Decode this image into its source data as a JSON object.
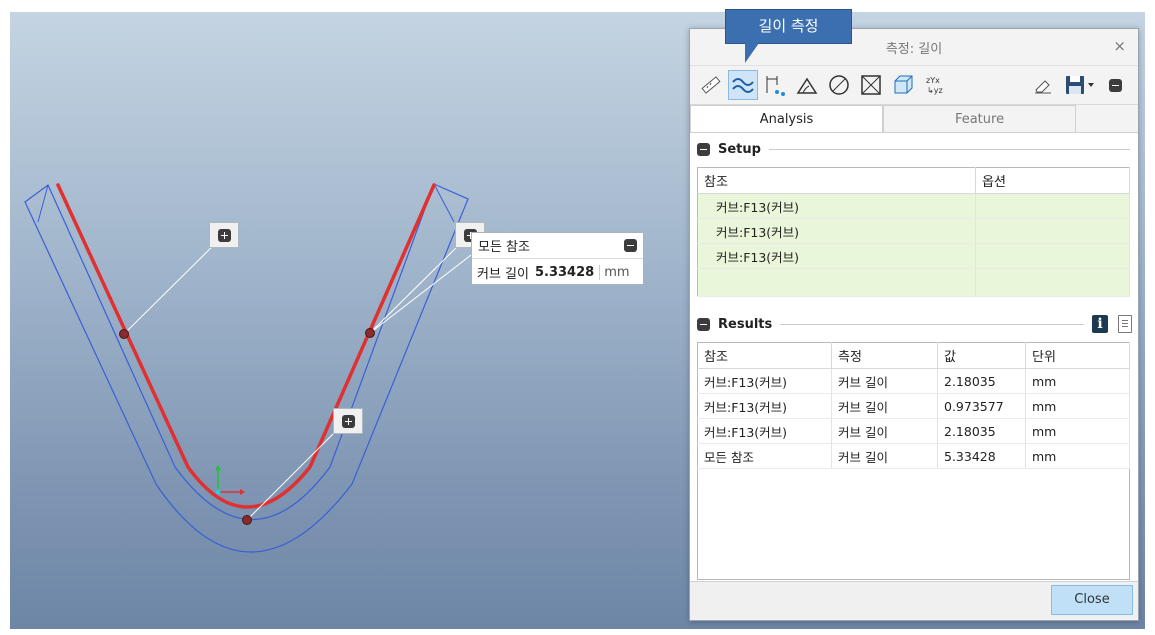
{
  "callout": "길이 측정",
  "window": {
    "title": "측정: 길이",
    "close_icon": "×"
  },
  "toolbar": {
    "tools": [
      "ruler-icon",
      "curve-length-icon",
      "distance-icon",
      "angle-icon",
      "diameter-icon",
      "area-icon",
      "volume-icon",
      "transform-icon"
    ],
    "right_tools": [
      "eraser-icon",
      "save-icon",
      "collapse-icon"
    ]
  },
  "tabs": [
    "Analysis",
    "Feature"
  ],
  "setup": {
    "title": "Setup",
    "columns": [
      "참조",
      "옵션"
    ],
    "rows": [
      "커브:F13(커브)",
      "커브:F13(커브)",
      "커브:F13(커브)"
    ]
  },
  "results": {
    "title": "Results",
    "columns": [
      "참조",
      "측정",
      "값",
      "단위"
    ],
    "rows": [
      [
        "커브:F13(커브)",
        "커브 길이",
        "2.18035",
        "mm"
      ],
      [
        "커브:F13(커브)",
        "커브 길이",
        "0.973577",
        "mm"
      ],
      [
        "커브:F13(커브)",
        "커브 길이",
        "2.18035",
        "mm"
      ],
      [
        "모든 참조",
        "커브 길이",
        "5.33428",
        "mm"
      ]
    ]
  },
  "footer": {
    "close_label": "Close"
  },
  "annotation": {
    "title": "모든 참조",
    "label": "커브 길이",
    "value": "5.33428",
    "unit": "mm"
  },
  "colors": {
    "curve": "#e03030",
    "outline": "#3a5fd6",
    "accent": "#3b6fb0",
    "setup_row": "#eaf6d9"
  }
}
